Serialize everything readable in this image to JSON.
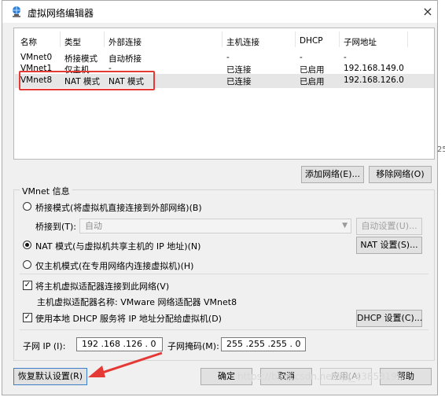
{
  "window": {
    "title": "虚拟网络编辑器",
    "close_glyph": "×"
  },
  "networks": {
    "columns": [
      "名称",
      "类型",
      "外部连接",
      "主机连接",
      "DHCP",
      "子网地址"
    ],
    "rows": [
      [
        "VMnet0",
        "桥接模式",
        "自动桥接",
        "-",
        "-",
        "-"
      ],
      [
        "VMnet1",
        "仅主机...",
        "-",
        "已连接",
        "已启用",
        "192.168.149.0"
      ],
      [
        "VMnet8",
        "NAT 模式",
        "NAT 模式",
        "已连接",
        "已启用",
        "192.168.126.0"
      ]
    ],
    "selected_row": 2
  },
  "buttons": {
    "add_network": "添加网络(E)...",
    "remove_network": "移除网络(O)",
    "auto_settings": "自动设置(U)...",
    "nat_settings": "NAT 设置(S)...",
    "dhcp_settings": "DHCP 设置(C)...",
    "restore_defaults": "恢复默认设置(R)",
    "ok": "确定",
    "cancel": "取消",
    "apply": "应用(A)",
    "help": "帮助"
  },
  "vmnet_info": {
    "group_label": "VMnet 信息",
    "bridged_label": "桥接模式(将虚拟机直接连接到外部网络)(B)",
    "bridged_to_label": "桥接到(T):",
    "bridged_to_value": "自动",
    "nat_label": "NAT 模式(与虚拟机共享主机的 IP 地址)(N)",
    "host_only_label": "仅主机模式(在专用网络内连接虚拟机)(H)",
    "mode_selected": "nat",
    "connect_adapter_label": "将主机虚拟适配器连接到此网络(V)",
    "connect_adapter_checked": true,
    "adapter_name_label": "主机虚拟适配器名称: VMware 网络适配器 VMnet8",
    "use_dhcp_label": "使用本地 DHCP 服务将 IP 地址分配给虚拟机(D)",
    "use_dhcp_checked": true,
    "subnet_ip_label": "子网 IP (I):",
    "subnet_ip_value": "192 .168 .126 . 0",
    "subnet_mask_label": "子网掩码(M):",
    "subnet_mask_value": "255 .255 .255 . 0"
  },
  "overlay": {
    "watermark": "https://blog.csdn.net/qq_43858196",
    "clipped_edge_text": "25",
    "highlight_color": "#e53935"
  }
}
